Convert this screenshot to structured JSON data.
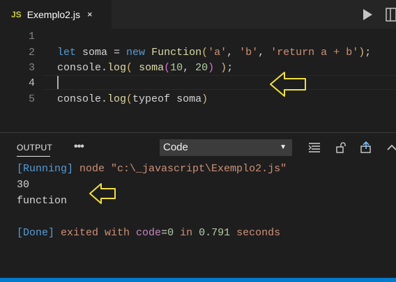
{
  "tab": {
    "lang_badge": "JS",
    "filename": "Exemplo2.js",
    "close_glyph": "×"
  },
  "editor": {
    "line_numbers": [
      "1",
      "2",
      "3",
      "4",
      "5"
    ],
    "line2": {
      "let": "let",
      "name": " soma ",
      "eq": "= ",
      "new": "new",
      "space": " ",
      "fn": "Function",
      "open": "(",
      "a": "'a'",
      "c1": ", ",
      "b": "'b'",
      "c2": ", ",
      "body": "'return a + b'",
      "close": ")",
      "semi": ";"
    },
    "line3": {
      "console": "console.",
      "log": "log",
      "open": "(",
      "mid": " ",
      "soma": "soma",
      "open2": "(",
      "n1": "10",
      "comma": ", ",
      "n2": "20",
      "close2": ")",
      "sp": " ",
      "close": ")",
      "semi": ";"
    },
    "line5": {
      "console": "console.",
      "log": "log",
      "open": "(",
      "typeof": "typeof",
      "rest": " soma",
      "close": ")"
    }
  },
  "panel": {
    "title": "OUTPUT",
    "more": "•••",
    "select": {
      "value": "Code",
      "arrow": "▼"
    },
    "output": {
      "running": "[Running]",
      "cmd_node": " node ",
      "cmd_path": "\"c:\\_javascript\\Exemplo2.js\"",
      "line2": "30",
      "line3": "function",
      "done": "[Done]",
      "exited": " exited with ",
      "code_kw": "code",
      "code_eq": "=",
      "code_val": "0",
      "in": " in ",
      "secs": "0.791",
      "seconds": " seconds"
    }
  },
  "colors": {
    "accent": "#007acc",
    "arrow": "#f0e040"
  }
}
